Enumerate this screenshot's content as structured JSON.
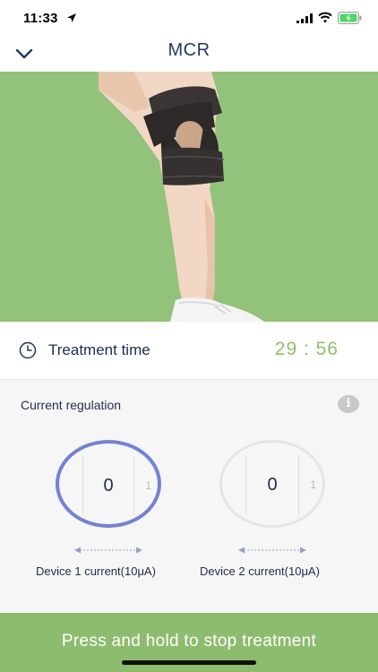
{
  "status_bar": {
    "time": "11:33"
  },
  "nav": {
    "title": "MCR"
  },
  "treatment": {
    "label": "Treatment time",
    "time": "29 : 56"
  },
  "regulation": {
    "title": "Current regulation",
    "info_glyph": "i",
    "devices": [
      {
        "value": "0",
        "next_value": "1",
        "label": "Device 1 current(10μA)",
        "active": true
      },
      {
        "value": "0",
        "next_value": "1",
        "label": "Device 2 current(10μA)",
        "active": false
      }
    ]
  },
  "stop_button": {
    "label": "Press and hold to stop treatment"
  },
  "colors": {
    "accent_green": "#8ebc6e",
    "time_green": "#8dbf6a",
    "dial_active": "#7382d1",
    "navy": "#1f2d4d"
  },
  "icons": [
    "location-arrow-icon",
    "signal-icon",
    "wifi-icon",
    "battery-icon",
    "chevron-down-icon",
    "clock-icon",
    "info-icon",
    "double-arrow-icon"
  ]
}
